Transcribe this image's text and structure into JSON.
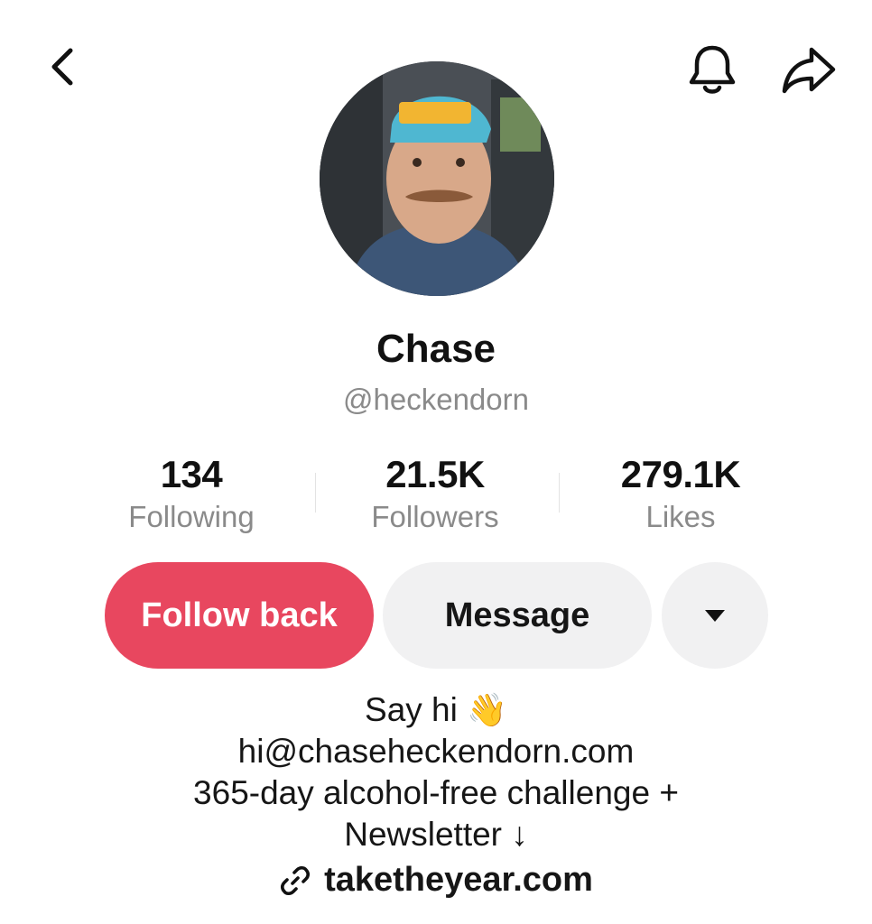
{
  "header": {
    "back_icon": "chevron-left-icon",
    "bell_icon": "bell-icon",
    "share_icon": "share-arrow-icon"
  },
  "profile": {
    "name": "Chase",
    "handle": "@heckendorn"
  },
  "stats": [
    {
      "value": "134",
      "label": "Following"
    },
    {
      "value": "21.5K",
      "label": "Followers"
    },
    {
      "value": "279.1K",
      "label": "Likes"
    }
  ],
  "actions": {
    "follow_back": "Follow back",
    "message": "Message",
    "more_icon": "caret-down-icon"
  },
  "bio": {
    "line1": "Say hi",
    "wave": "👋",
    "line2": "hi@chaseheckendorn.com",
    "line3": "365-day alcohol-free challenge +",
    "line4": "Newsletter ↓"
  },
  "link": {
    "icon": "link-icon",
    "text": "taketheyear.com"
  },
  "colors": {
    "follow_button": "#e8475f",
    "secondary_button": "#f1f1f2",
    "muted_text": "#8a8a8a"
  }
}
